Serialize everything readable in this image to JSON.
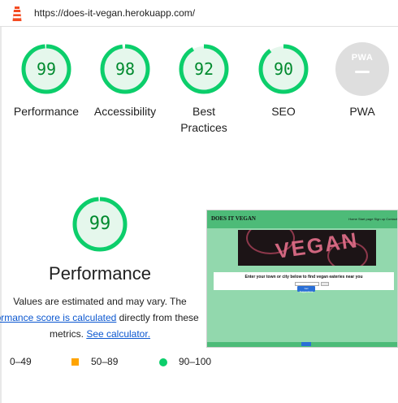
{
  "url": "https://does-it-vegan.herokuapp.com/",
  "colors": {
    "pass": "#0cce6b",
    "pass_text": "#008a2e",
    "average": "#ffa400",
    "fail": "#ff4e42",
    "pwa_gray": "#dedede"
  },
  "categories": [
    {
      "label": "Performance",
      "score": 99
    },
    {
      "label": "Accessibility",
      "score": 98
    },
    {
      "label": "Best Practices",
      "score": 92,
      "label_lines": [
        "Best",
        "Practices"
      ]
    },
    {
      "label": "SEO",
      "score": 90
    }
  ],
  "pwa": {
    "badge_text": "PWA",
    "label": "PWA"
  },
  "performance": {
    "score": 99,
    "title": "Performance",
    "desc_line1": "Values are estimated and may vary. The",
    "link1": "rformance score is calculated",
    "desc_after_link1": " directly from these",
    "desc_line3_pre": "metrics. ",
    "link2": "See calculator."
  },
  "legend": [
    {
      "range": "0–49",
      "color": "fail"
    },
    {
      "range": "50–89",
      "color": "average"
    },
    {
      "range": "90–100",
      "color": "pass"
    }
  ],
  "thumbnail": {
    "brand": "DOES IT VEGAN",
    "nav_links": "Home  Start page  Sign up  Contact",
    "hero_text": "VEGAN",
    "search_prompt": "Enter your town or city below to find vegan eateries near you",
    "button_text": "Get Suggestions"
  }
}
